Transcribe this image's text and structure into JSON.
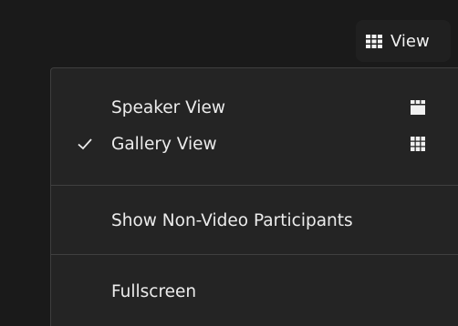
{
  "toolbar": {
    "view_button": {
      "label": "View",
      "icon": "grid-icon"
    }
  },
  "view_menu": {
    "items": [
      {
        "label": "Speaker View",
        "checked": false,
        "icon": "speaker-view-icon"
      },
      {
        "label": "Gallery View",
        "checked": true,
        "icon": "gallery-view-icon"
      },
      {
        "label": "Show Non-Video Participants",
        "checked": false
      },
      {
        "label": "Fullscreen",
        "checked": false
      }
    ]
  },
  "colors": {
    "background": "#1a1a1a",
    "menu_background": "#242424",
    "divider": "#3f3f3f",
    "text": "#ececec"
  }
}
